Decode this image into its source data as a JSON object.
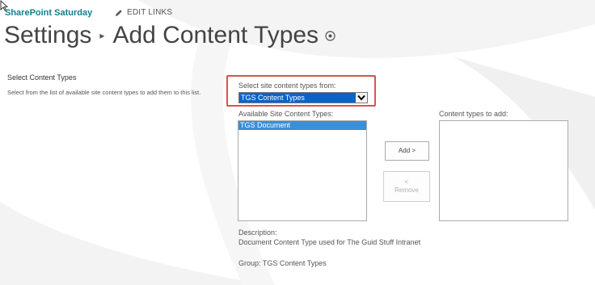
{
  "header": {
    "site_title": "SharePoint Saturday",
    "edit_links": "EDIT LINKS"
  },
  "title": {
    "settings": "Settings",
    "current": "Add Content Types"
  },
  "section": {
    "heading": "Select Content Types",
    "description": "Select from the list of available site content types to add them to this list."
  },
  "form": {
    "source_label": "Select site content types from:",
    "source_selected": "TGS Content Types",
    "available_label": "Available Site Content Types:",
    "available_items": [
      "TGS Document"
    ],
    "toadd_label": "Content types to add:",
    "add_button": "Add >",
    "remove_button_arrow": "<",
    "remove_button_label": "Remove",
    "description_label": "Description:",
    "description_value": "Document Content Type used for The Guid Stuff Intranet",
    "group_text": "Group: TGS Content Types"
  },
  "icons": {
    "pencil": "pencil-icon",
    "info": "info-icon",
    "dropdown": "chevron-down-icon",
    "breadcrumb_separator": "triangle-right-icon"
  },
  "colors": {
    "site_title": "#0f7f8f",
    "highlight_border": "#d9534f",
    "select_highlight": "#0a63c9",
    "list_selected": "#3a8fd6"
  }
}
